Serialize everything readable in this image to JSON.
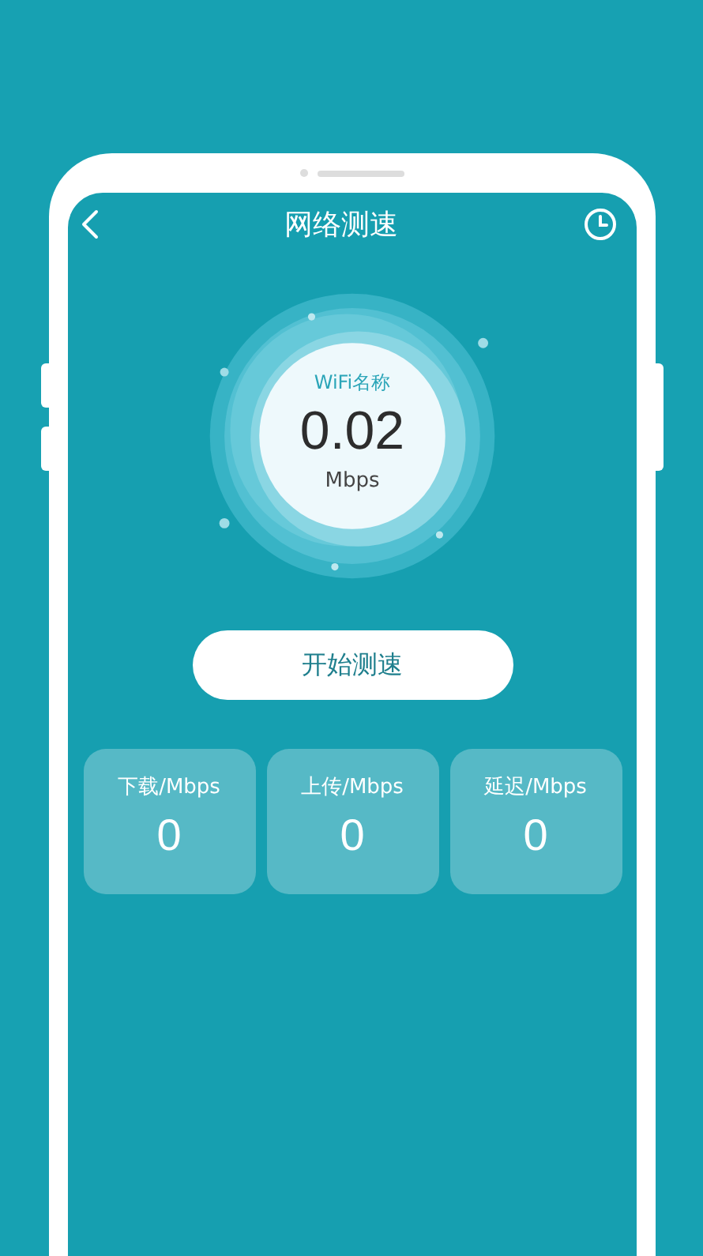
{
  "header": {
    "title": "网络测速"
  },
  "gauge": {
    "label": "WiFi名称",
    "value": "0.02",
    "unit": "Mbps"
  },
  "start_button": {
    "label": "开始测速"
  },
  "stats": [
    {
      "label": "下载/Mbps",
      "value": "0"
    },
    {
      "label": "上传/Mbps",
      "value": "0"
    },
    {
      "label": "延迟/Mbps",
      "value": "0"
    }
  ]
}
